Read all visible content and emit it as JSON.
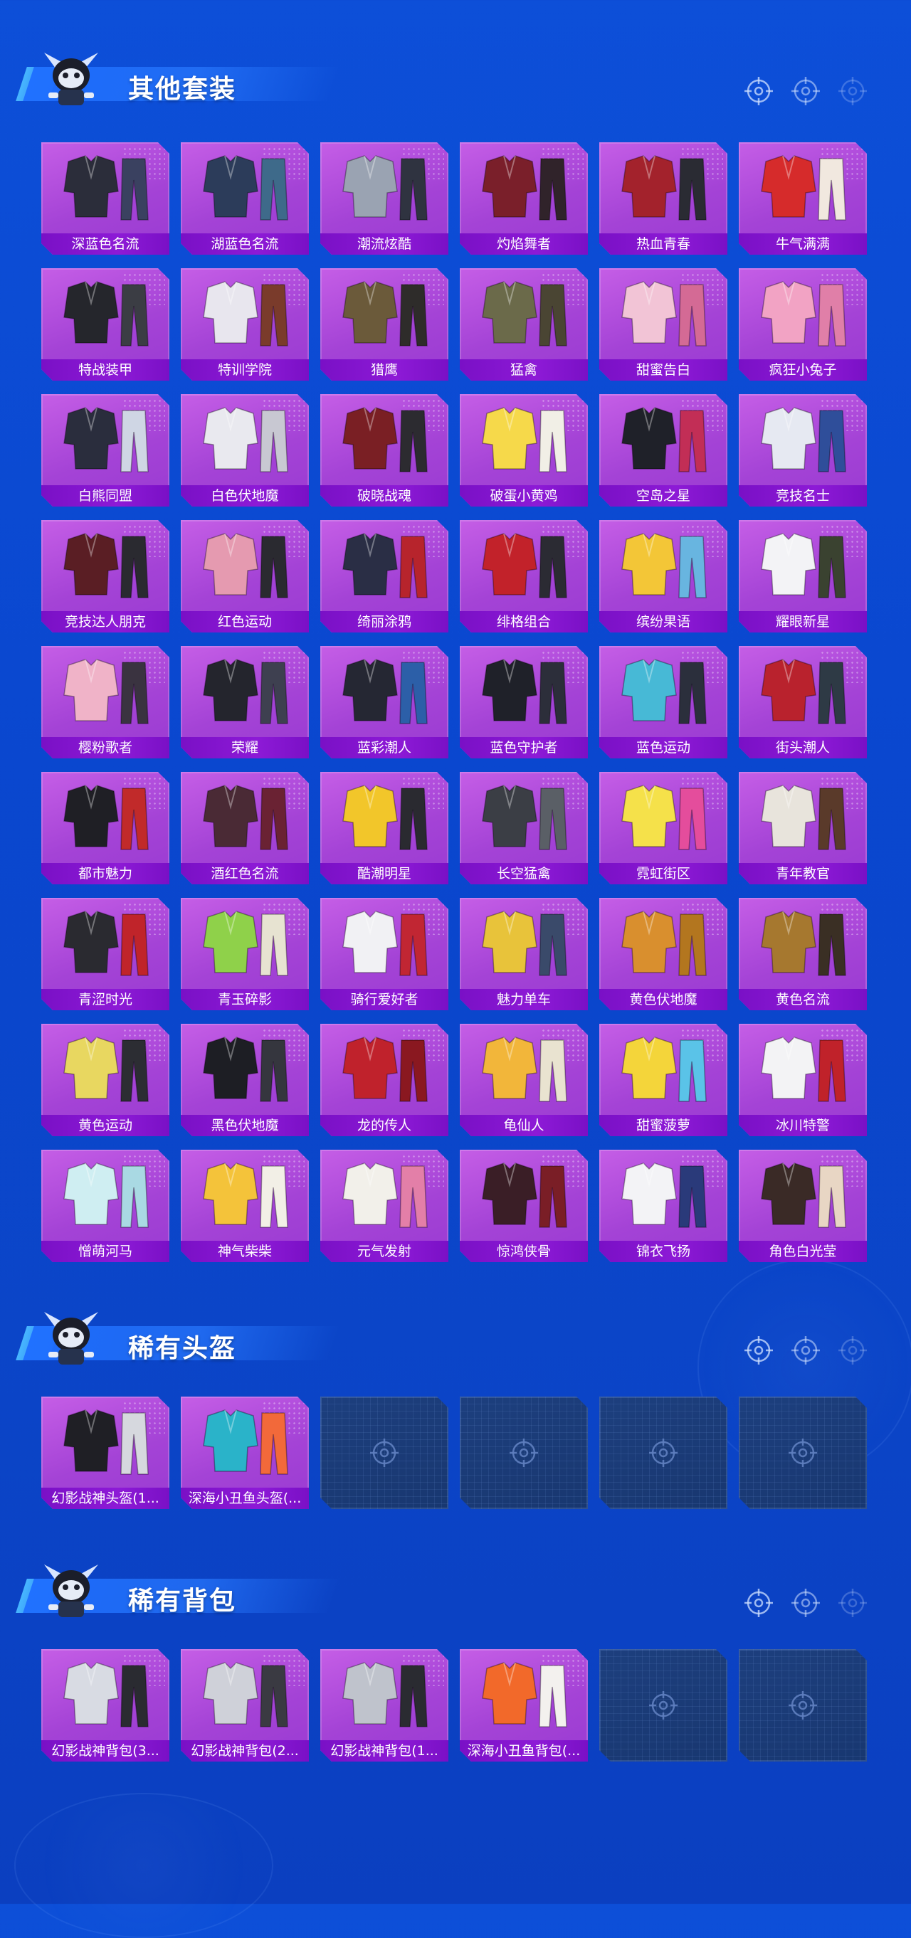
{
  "sections": [
    {
      "title": "其他套装",
      "items": [
        {
          "label": "深蓝色名流",
          "palette": [
            "#2b2d3a",
            "#3a4160"
          ]
        },
        {
          "label": "湖蓝色名流",
          "palette": [
            "#2c3c5a",
            "#3e6a8a"
          ]
        },
        {
          "label": "潮流炫酷",
          "palette": [
            "#9aa3b2",
            "#2f3340"
          ]
        },
        {
          "label": "灼焰舞者",
          "palette": [
            "#7a1f2a",
            "#30232a"
          ]
        },
        {
          "label": "热血青春",
          "palette": [
            "#a3222c",
            "#2a2b33"
          ]
        },
        {
          "label": "牛气满满",
          "palette": [
            "#d62b2b",
            "#f1e8df"
          ]
        },
        {
          "label": "特战装甲",
          "palette": [
            "#25262c",
            "#3b3d44"
          ]
        },
        {
          "label": "特训学院",
          "palette": [
            "#e8e6ee",
            "#7a3b2b"
          ]
        },
        {
          "label": "猎鹰",
          "palette": [
            "#6b5a3a",
            "#2e2c2a"
          ]
        },
        {
          "label": "猛禽",
          "palette": [
            "#6b6a4a",
            "#4a4533"
          ]
        },
        {
          "label": "甜蜜告白",
          "palette": [
            "#f2c4d6",
            "#d46a95"
          ]
        },
        {
          "label": "疯狂小兔子",
          "palette": [
            "#f2a3c4",
            "#e07fa8"
          ]
        },
        {
          "label": "白熊同盟",
          "palette": [
            "#2a2d3d",
            "#cfd6e4"
          ]
        },
        {
          "label": "白色伏地魔",
          "palette": [
            "#e9e9ef",
            "#c8c8d2"
          ]
        },
        {
          "label": "破晓战魂",
          "palette": [
            "#7a1f24",
            "#2c2b30"
          ]
        },
        {
          "label": "破蛋小黄鸡",
          "palette": [
            "#f6d94a",
            "#f1efe6"
          ]
        },
        {
          "label": "空岛之星",
          "palette": [
            "#1f2129",
            "#c22e56"
          ]
        },
        {
          "label": "竞技名士",
          "palette": [
            "#e6e9f2",
            "#2f4e9a"
          ]
        },
        {
          "label": "竞技达人朋克",
          "palette": [
            "#5a1e24",
            "#2a2a30"
          ]
        },
        {
          "label": "红色运动",
          "palette": [
            "#e59ab0",
            "#2a2a30"
          ]
        },
        {
          "label": "绮丽涂鸦",
          "palette": [
            "#2a2e45",
            "#b7242c"
          ]
        },
        {
          "label": "绯格组合",
          "palette": [
            "#c2222a",
            "#2b2b33"
          ]
        },
        {
          "label": "缤纷果语",
          "palette": [
            "#f3c637",
            "#68b5e0"
          ]
        },
        {
          "label": "耀眼新星",
          "palette": [
            "#f3f3f6",
            "#3a4230"
          ]
        },
        {
          "label": "樱粉歌者",
          "palette": [
            "#f0b3c8",
            "#3a3340"
          ]
        },
        {
          "label": "荣耀",
          "palette": [
            "#24252d",
            "#3e4050"
          ]
        },
        {
          "label": "蓝彩潮人",
          "palette": [
            "#252733",
            "#2c5fa8"
          ]
        },
        {
          "label": "蓝色守护者",
          "palette": [
            "#1f2129",
            "#2c2e3a"
          ]
        },
        {
          "label": "蓝色运动",
          "palette": [
            "#47b9d6",
            "#2b2f3c"
          ]
        },
        {
          "label": "街头潮人",
          "palette": [
            "#b9222d",
            "#2e3a45"
          ]
        },
        {
          "label": "都市魅力",
          "palette": [
            "#1f1f25",
            "#c12a2a"
          ]
        },
        {
          "label": "酒红色名流",
          "palette": [
            "#4a2a35",
            "#6a2233"
          ]
        },
        {
          "label": "酷潮明星",
          "palette": [
            "#f2c62a",
            "#2a2a30"
          ]
        },
        {
          "label": "长空猛禽",
          "palette": [
            "#3b3e45",
            "#5a5f66"
          ]
        },
        {
          "label": "霓虹街区",
          "palette": [
            "#f5e14a",
            "#e44d9c"
          ]
        },
        {
          "label": "青年教官",
          "palette": [
            "#e8e4dc",
            "#5a3a2a"
          ]
        },
        {
          "label": "青涩时光",
          "palette": [
            "#2a2a30",
            "#c0242a"
          ]
        },
        {
          "label": "青玉碎影",
          "palette": [
            "#8fd14a",
            "#e7e3d1"
          ]
        },
        {
          "label": "骑行爱好者",
          "palette": [
            "#f1f1f4",
            "#c12633"
          ]
        },
        {
          "label": "魅力单车",
          "palette": [
            "#e8c33a",
            "#3a4a6a"
          ]
        },
        {
          "label": "黄色伏地魔",
          "palette": [
            "#d98f2e",
            "#b3761f"
          ]
        },
        {
          "label": "黄色名流",
          "palette": [
            "#a6782f",
            "#3a2f24"
          ]
        },
        {
          "label": "黄色运动",
          "palette": [
            "#e8d760",
            "#2c2d33"
          ]
        },
        {
          "label": "黑色伏地魔",
          "palette": [
            "#1d1e24",
            "#35363e"
          ]
        },
        {
          "label": "龙的传人",
          "palette": [
            "#c0222c",
            "#8a1820"
          ]
        },
        {
          "label": "龟仙人",
          "palette": [
            "#f2b63a",
            "#e9e3d0"
          ]
        },
        {
          "label": "甜蜜菠萝",
          "palette": [
            "#f4d53a",
            "#5ac3e8"
          ]
        },
        {
          "label": "冰川特警",
          "palette": [
            "#f3f3f5",
            "#c0222a"
          ]
        },
        {
          "label": "憎萌河马",
          "palette": [
            "#cfeef2",
            "#a9d9e3"
          ]
        },
        {
          "label": "神气柴柴",
          "palette": [
            "#f4c33a",
            "#f2efe6"
          ]
        },
        {
          "label": "元气发射",
          "palette": [
            "#f2f0ea",
            "#e37fa8"
          ]
        },
        {
          "label": "惊鸿侠骨",
          "palette": [
            "#3a1e26",
            "#7a1e26"
          ]
        },
        {
          "label": "锦衣飞扬",
          "palette": [
            "#f3f3f6",
            "#2a3a7a"
          ]
        },
        {
          "label": "角色白光莹",
          "palette": [
            "#3a2a26",
            "#e8d6c4"
          ]
        }
      ],
      "empty_slots": 0
    },
    {
      "title": "稀有头盔",
      "items": [
        {
          "label": "幻影战神头盔(1...",
          "palette": [
            "#1f1f25",
            "#d6d8de"
          ]
        },
        {
          "label": "深海小丑鱼头盔(...",
          "palette": [
            "#2ab3c9",
            "#f2693a"
          ]
        }
      ],
      "empty_slots": 4
    },
    {
      "title": "稀有背包",
      "items": [
        {
          "label": "幻影战神背包(3...",
          "palette": [
            "#d8dbe3",
            "#2a2b31"
          ]
        },
        {
          "label": "幻影战神背包(2...",
          "palette": [
            "#cfd1d9",
            "#3a3a42"
          ]
        },
        {
          "label": "幻影战神背包(1...",
          "palette": [
            "#bfc3cc",
            "#2a2b31"
          ]
        },
        {
          "label": "深海小丑鱼背包(...",
          "palette": [
            "#f2692a",
            "#f3f1ee"
          ]
        }
      ],
      "empty_slots": 2
    }
  ],
  "icons": {
    "header_mascot": "mascot-icon",
    "header_deco": "crosshair-icon",
    "empty_slot": "crosshair-icon"
  },
  "colors": {
    "card_purple": "#a443d6",
    "label_purple": "#8d1ad6",
    "empty_slot": "#1d3f7e",
    "background": "#0b47cf"
  }
}
